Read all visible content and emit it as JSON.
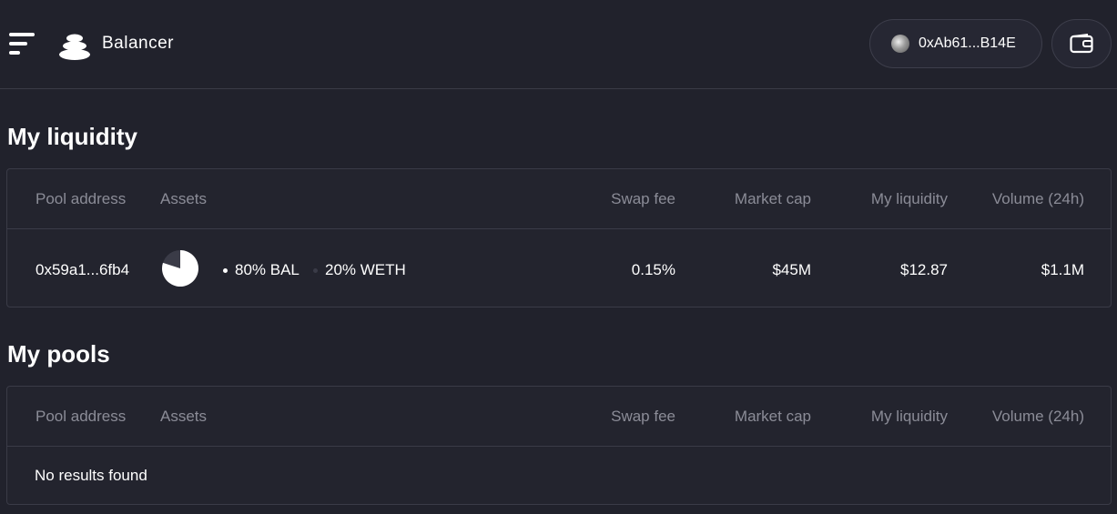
{
  "header": {
    "brand": "Balancer",
    "account_address": "0xAb61...B14E"
  },
  "columns": [
    "Pool address",
    "Assets",
    "Swap fee",
    "Market cap",
    "My liquidity",
    "Volume (24h)"
  ],
  "my_liquidity": {
    "title": "My liquidity",
    "rows": [
      {
        "pool_address": "0x59a1...6fb4",
        "assets": [
          {
            "label": "80% BAL",
            "color": "#ffffff"
          },
          {
            "label": "20% WETH",
            "color": "#3a3b47"
          }
        ],
        "pie_fraction": 0.8,
        "swap_fee": "0.15%",
        "market_cap": "$45M",
        "my_liquidity": "$12.87",
        "volume_24h": "$1.1M"
      }
    ]
  },
  "my_pools": {
    "title": "My pools",
    "empty_text": "No results found"
  }
}
